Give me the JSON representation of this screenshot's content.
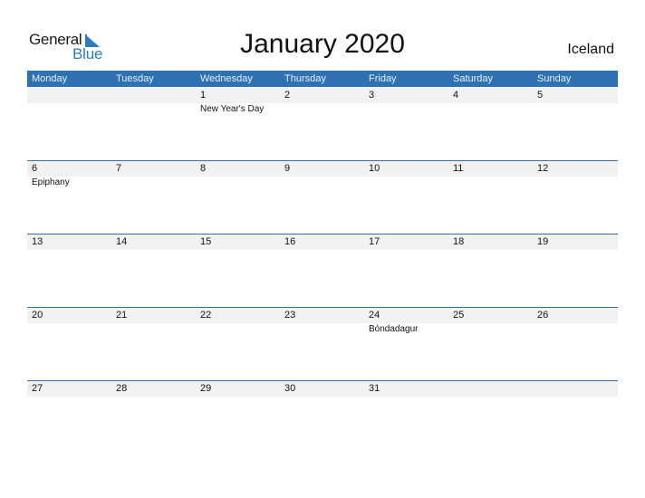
{
  "logo": {
    "general": "General",
    "blue": "Blue"
  },
  "title": "January 2020",
  "country": "Iceland",
  "colors": {
    "accent": "#2e72b4",
    "logo_blue": "#2a7dc4",
    "strip": "#f2f2f2"
  },
  "weekdays": [
    "Monday",
    "Tuesday",
    "Wednesday",
    "Thursday",
    "Friday",
    "Saturday",
    "Sunday"
  ],
  "weeks": [
    {
      "days": [
        {
          "num": "",
          "event": ""
        },
        {
          "num": "",
          "event": ""
        },
        {
          "num": "1",
          "event": "New Year's Day"
        },
        {
          "num": "2",
          "event": ""
        },
        {
          "num": "3",
          "event": ""
        },
        {
          "num": "4",
          "event": ""
        },
        {
          "num": "5",
          "event": ""
        }
      ]
    },
    {
      "days": [
        {
          "num": "6",
          "event": "Epiphany"
        },
        {
          "num": "7",
          "event": ""
        },
        {
          "num": "8",
          "event": ""
        },
        {
          "num": "9",
          "event": ""
        },
        {
          "num": "10",
          "event": ""
        },
        {
          "num": "11",
          "event": ""
        },
        {
          "num": "12",
          "event": ""
        }
      ]
    },
    {
      "days": [
        {
          "num": "13",
          "event": ""
        },
        {
          "num": "14",
          "event": ""
        },
        {
          "num": "15",
          "event": ""
        },
        {
          "num": "16",
          "event": ""
        },
        {
          "num": "17",
          "event": ""
        },
        {
          "num": "18",
          "event": ""
        },
        {
          "num": "19",
          "event": ""
        }
      ]
    },
    {
      "days": [
        {
          "num": "20",
          "event": ""
        },
        {
          "num": "21",
          "event": ""
        },
        {
          "num": "22",
          "event": ""
        },
        {
          "num": "23",
          "event": ""
        },
        {
          "num": "24",
          "event": "Bóndadagur"
        },
        {
          "num": "25",
          "event": ""
        },
        {
          "num": "26",
          "event": ""
        }
      ]
    },
    {
      "days": [
        {
          "num": "27",
          "event": ""
        },
        {
          "num": "28",
          "event": ""
        },
        {
          "num": "29",
          "event": ""
        },
        {
          "num": "30",
          "event": ""
        },
        {
          "num": "31",
          "event": ""
        },
        {
          "num": "",
          "event": ""
        },
        {
          "num": "",
          "event": ""
        }
      ]
    }
  ]
}
